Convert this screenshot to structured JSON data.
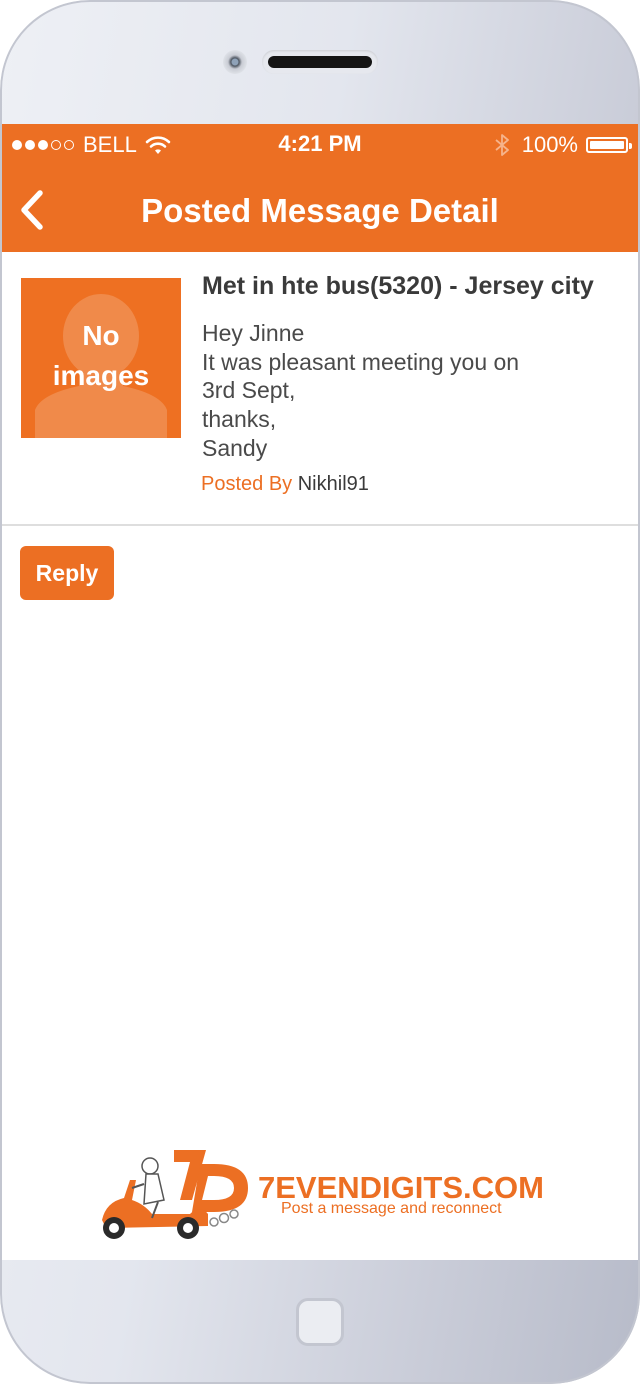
{
  "status_bar": {
    "signal_dots_filled": 3,
    "signal_dots_total": 5,
    "carrier": "BELL",
    "time": "4:21 PM",
    "battery_text": "100%",
    "battery_level": 1.0
  },
  "nav": {
    "title": "Posted Message Detail",
    "back_icon": "chevron-left-icon"
  },
  "message": {
    "image_placeholder": [
      "No",
      "images"
    ],
    "title": "Met in hte bus(5320) - Jersey city",
    "body_lines": [
      "Hey Jinne",
      "It was pleasant meeting you on",
      "3rd Sept,",
      "thanks,",
      "Sandy"
    ],
    "posted_by_label": "Posted By",
    "posted_by_user": "Nikhil91"
  },
  "actions": {
    "reply_label": "Reply"
  },
  "footer_logo": {
    "name": "7EVENDIGITS.COM",
    "tagline": "Post a message and reconnect",
    "mark": "7D"
  },
  "colors": {
    "accent": "#ec6f23",
    "text_dark": "#3a3a3a",
    "divider": "#dedede"
  }
}
